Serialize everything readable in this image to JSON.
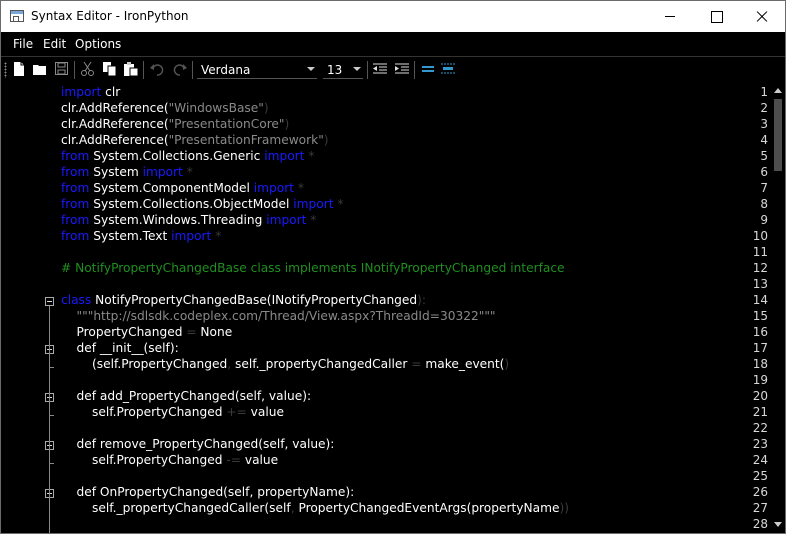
{
  "window": {
    "title": "Syntax Editor - IronPython"
  },
  "menu": {
    "file": "File",
    "edit": "Edit",
    "options": "Options"
  },
  "toolbar": {
    "font_family": "Verdana",
    "font_size": "13"
  },
  "colors": {
    "keyword": "#1a1aff",
    "string": "#8a8a8a",
    "comment": "#1f8f1f",
    "text": "#ffffff",
    "background": "#000000"
  },
  "editor": {
    "line_numbers": [
      "1",
      "2",
      "3",
      "4",
      "5",
      "6",
      "7",
      "8",
      "9",
      "10",
      "11",
      "12",
      "13",
      "14",
      "15",
      "16",
      "17",
      "18",
      "19",
      "20",
      "21",
      "22",
      "23",
      "24",
      "25",
      "26",
      "27",
      "28"
    ],
    "lines": [
      [
        {
          "t": "import",
          "c": "kw"
        },
        {
          "t": " clr",
          "c": ""
        }
      ],
      [
        {
          "t": "clr.AddReference(",
          "c": ""
        },
        {
          "t": "\"WindowsBase\"",
          "c": "str"
        },
        {
          "t": ")",
          "c": "dim"
        }
      ],
      [
        {
          "t": "clr.AddReference(",
          "c": ""
        },
        {
          "t": "\"PresentationCore\"",
          "c": "str"
        },
        {
          "t": ")",
          "c": "dim"
        }
      ],
      [
        {
          "t": "clr.AddReference(",
          "c": ""
        },
        {
          "t": "\"PresentationFramework\"",
          "c": "str"
        },
        {
          "t": ")",
          "c": "dim"
        }
      ],
      [
        {
          "t": "from",
          "c": "kw"
        },
        {
          "t": " System.Collections.Generic ",
          "c": ""
        },
        {
          "t": "import",
          "c": "kw"
        },
        {
          "t": " *",
          "c": "dim"
        }
      ],
      [
        {
          "t": "from",
          "c": "kw"
        },
        {
          "t": " System ",
          "c": ""
        },
        {
          "t": "import",
          "c": "kw"
        },
        {
          "t": " *",
          "c": "dim"
        }
      ],
      [
        {
          "t": "from",
          "c": "kw"
        },
        {
          "t": " System.ComponentModel ",
          "c": ""
        },
        {
          "t": "import",
          "c": "kw"
        },
        {
          "t": " *",
          "c": "dim"
        }
      ],
      [
        {
          "t": "from",
          "c": "kw"
        },
        {
          "t": " System.Collections.ObjectModel ",
          "c": ""
        },
        {
          "t": "import",
          "c": "kw"
        },
        {
          "t": " *",
          "c": "dim"
        }
      ],
      [
        {
          "t": "from",
          "c": "kw"
        },
        {
          "t": " System.Windows.Threading ",
          "c": ""
        },
        {
          "t": "import",
          "c": "kw"
        },
        {
          "t": " *",
          "c": "dim"
        }
      ],
      [
        {
          "t": "from",
          "c": "kw"
        },
        {
          "t": " System.Text ",
          "c": ""
        },
        {
          "t": "import",
          "c": "kw"
        },
        {
          "t": " *",
          "c": "dim"
        }
      ],
      [],
      [
        {
          "t": "# NotifyPropertyChangedBase class implements INotifyPropertyChanged interface",
          "c": "cmt"
        }
      ],
      [],
      [
        {
          "t": "class",
          "c": "kw"
        },
        {
          "t": " NotifyPropertyChangedBase(INotifyPropertyChanged",
          "c": ""
        },
        {
          "t": "):",
          "c": "dim"
        }
      ],
      [
        {
          "t": "    ",
          "c": ""
        },
        {
          "t": "\"\"\"http://sdlsdk.codeplex.com/Thread/View.aspx?ThreadId=30322\"\"\"",
          "c": "str"
        }
      ],
      [
        {
          "t": "    PropertyChanged ",
          "c": ""
        },
        {
          "t": "=",
          "c": "dim"
        },
        {
          "t": " None",
          "c": ""
        }
      ],
      [
        {
          "t": "    def __init__(self):",
          "c": ""
        }
      ],
      [
        {
          "t": "        (self.PropertyChanged",
          "c": ""
        },
        {
          "t": ",",
          "c": "dim"
        },
        {
          "t": " self._propertyChangedCaller ",
          "c": ""
        },
        {
          "t": "=",
          "c": "dim"
        },
        {
          "t": " make_event(",
          "c": ""
        },
        {
          "t": ")",
          "c": "dim"
        }
      ],
      [],
      [
        {
          "t": "    def add_PropertyChanged(self, value):",
          "c": ""
        }
      ],
      [
        {
          "t": "        self.PropertyChanged ",
          "c": ""
        },
        {
          "t": "+=",
          "c": "dim"
        },
        {
          "t": " value",
          "c": ""
        }
      ],
      [],
      [
        {
          "t": "    def remove_PropertyChanged(self, value):",
          "c": ""
        }
      ],
      [
        {
          "t": "        self.PropertyChanged ",
          "c": ""
        },
        {
          "t": "-=",
          "c": "dim"
        },
        {
          "t": " value",
          "c": ""
        }
      ],
      [],
      [
        {
          "t": "    def OnPropertyChanged(self, propertyName):",
          "c": ""
        }
      ],
      [
        {
          "t": "        self._propertyChangedCaller(self",
          "c": ""
        },
        {
          "t": ",",
          "c": "dim"
        },
        {
          "t": " PropertyChangedEventArgs(propertyName",
          "c": ""
        },
        {
          "t": "))",
          "c": "dim"
        }
      ],
      []
    ]
  }
}
